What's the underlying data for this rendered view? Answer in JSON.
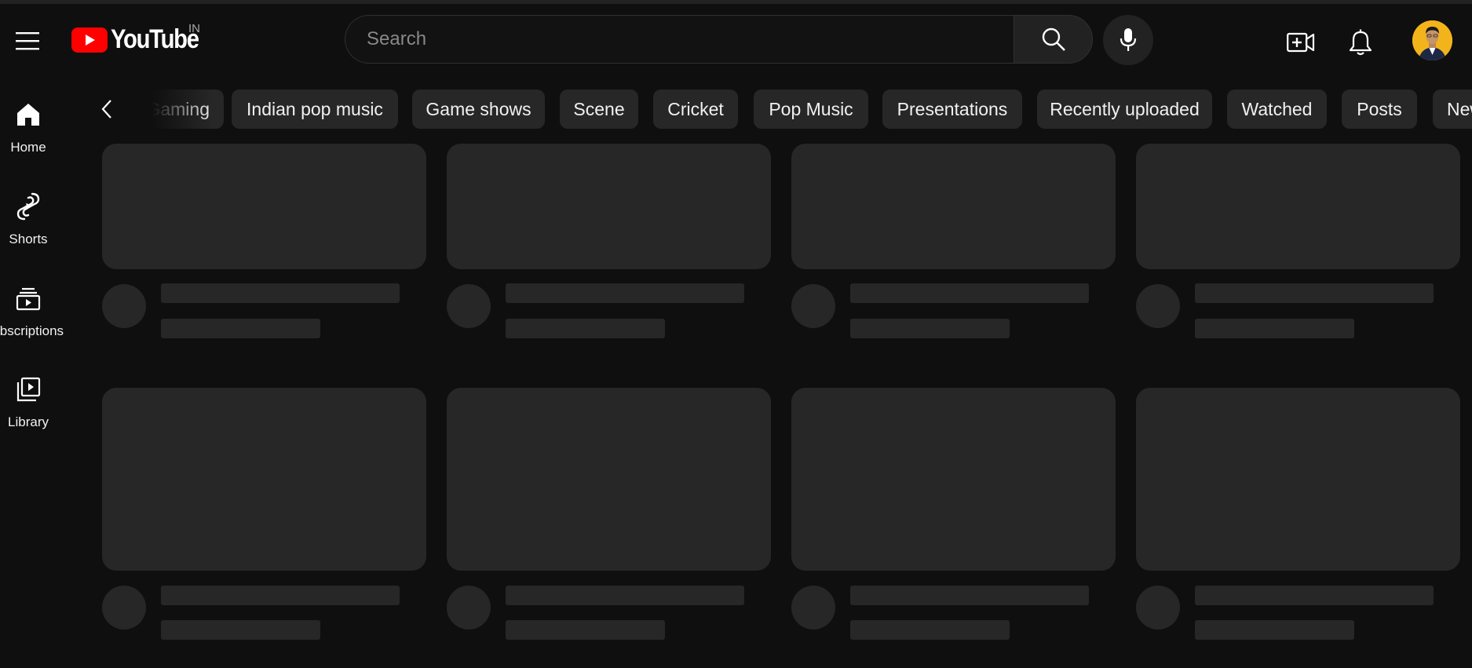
{
  "app": {
    "logo_text": "YouTube",
    "country": "IN",
    "brand_color": "#ff0000"
  },
  "search": {
    "placeholder": "Search"
  },
  "header_icons": [
    "menu-icon",
    "search-icon",
    "mic-icon",
    "create-video-icon",
    "bell-icon",
    "avatar"
  ],
  "sidebar": {
    "items": [
      {
        "label": "Home",
        "icon": "home-icon"
      },
      {
        "label": "Shorts",
        "icon": "shorts-icon"
      },
      {
        "label": "Subscriptions",
        "icon": "subscriptions-icon"
      },
      {
        "label": "Library",
        "icon": "library-icon"
      }
    ]
  },
  "chips": [
    {
      "label": "Gaming"
    },
    {
      "label": "Indian pop music"
    },
    {
      "label": "Game shows"
    },
    {
      "label": "Scene"
    },
    {
      "label": "Cricket"
    },
    {
      "label": "Pop Music"
    },
    {
      "label": "Presentations"
    },
    {
      "label": "Recently uploaded"
    },
    {
      "label": "Watched"
    },
    {
      "label": "Posts"
    },
    {
      "label": "New to you"
    }
  ],
  "feed": {
    "state": "loading",
    "placeholder_cards": 8
  }
}
